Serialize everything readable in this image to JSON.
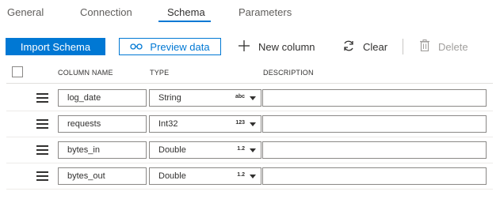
{
  "tabs": [
    {
      "label": "General"
    },
    {
      "label": "Connection"
    },
    {
      "label": "Schema",
      "active": true
    },
    {
      "label": "Parameters"
    }
  ],
  "toolbar": {
    "import_label": "Import Schema",
    "preview_label": "Preview data",
    "new_column_label": "New column",
    "clear_label": "Clear",
    "delete_label": "Delete"
  },
  "table": {
    "headers": {
      "column_name": "COLUMN NAME",
      "type": "TYPE",
      "description": "DESCRIPTION"
    },
    "rows": [
      {
        "name": "log_date",
        "type": "String",
        "type_glyph": "abc",
        "description": ""
      },
      {
        "name": "requests",
        "type": "Int32",
        "type_glyph": "123",
        "description": ""
      },
      {
        "name": "bytes_in",
        "type": "Double",
        "type_glyph": "1.2",
        "description": ""
      },
      {
        "name": "bytes_out",
        "type": "Double",
        "type_glyph": "1.2",
        "description": ""
      }
    ]
  },
  "colors": {
    "accent": "#0078d4",
    "disabled": "#a19f9d",
    "border": "#8a8886"
  }
}
